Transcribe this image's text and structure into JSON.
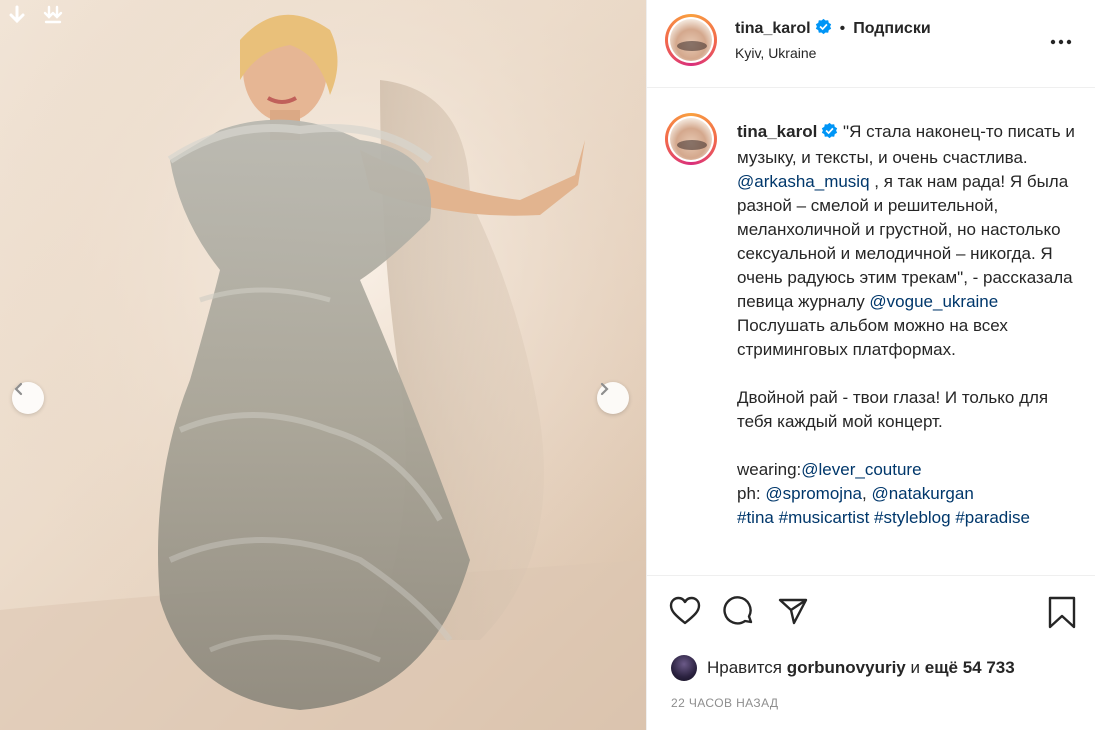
{
  "photo": {
    "alt": ""
  },
  "header": {
    "username": "tina_karol",
    "dot": "•",
    "follow_label": "Подписки",
    "location": "Kyiv, Ukraine"
  },
  "caption": {
    "username": "tina_karol",
    "p1": "\"Я стала наконец-то писать и музыку, и тексты, и очень счастлива.",
    "m1": "@arkasha_musiq",
    "p2": " , я так нам рада! Я была разной – смелой и решительной, меланхоличной и грустной, но настолько сексуальной и мелодичной – никогда. Я очень радуюсь этим трекам\", - рассказала певица журналу ",
    "m2": "@vogue_ukraine",
    "p3": "Послушать альбом можно на всех стриминговых платформах.\n\nДвойной рай - твои глаза! И только для тебя каждый мой концерт.\n\nwearing:",
    "m3": "@lever_couture",
    "p4": "ph: ",
    "m4": "@spromojna",
    "p5": ", ",
    "m5": "@natakurgan",
    "t1": "#tina",
    "t2": "#musicartist",
    "t3": "#styleblog",
    "t4": "#paradise"
  },
  "likes": {
    "prefix": "Нравится",
    "user": "gorbunovyuriy",
    "middle": "и",
    "rest": "ещё 54 733"
  },
  "timestamp": "22 ЧАСОВ НАЗАД",
  "colors": {
    "link": "#00376b",
    "verified": "#0095f6",
    "muted": "#8e8e8e"
  }
}
